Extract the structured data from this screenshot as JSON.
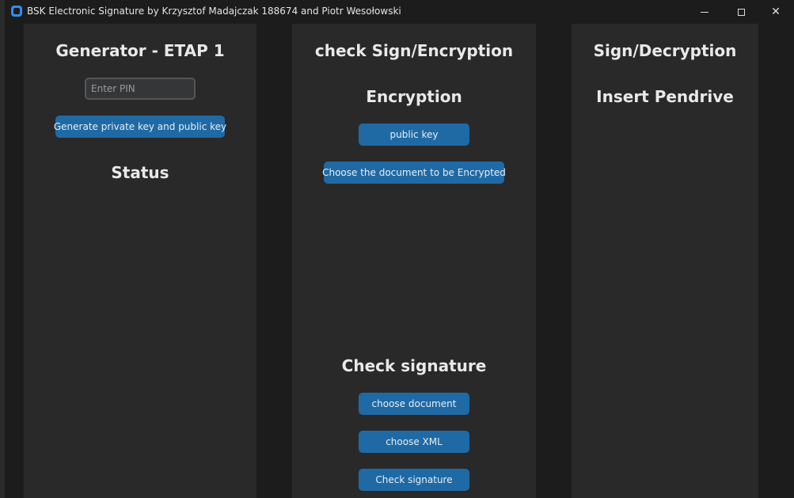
{
  "window": {
    "title": "BSK Electronic Signature by Krzysztof Madajczak 188674 and Piotr Wesołowski"
  },
  "generator": {
    "heading": "Generator - ETAP 1",
    "pin_placeholder": "Enter PIN",
    "generate_button": "Generate private key and public key",
    "status_heading": "Status"
  },
  "check": {
    "heading": "check Sign/Encryption",
    "encryption_heading": "Encryption",
    "public_key_button": "public key",
    "choose_encrypt_button": "Choose the document to be Encrypted",
    "check_signature_heading": "Check signature",
    "choose_document_button": "choose document",
    "choose_xml_button": "choose XML",
    "check_signature_button": "Check signature"
  },
  "sign": {
    "heading": "Sign/Decryption",
    "insert_pendrive_heading": "Insert Pendrive"
  },
  "colors": {
    "button": "#1f6aa5",
    "panel": "#292929",
    "background": "#1c1c1c"
  }
}
